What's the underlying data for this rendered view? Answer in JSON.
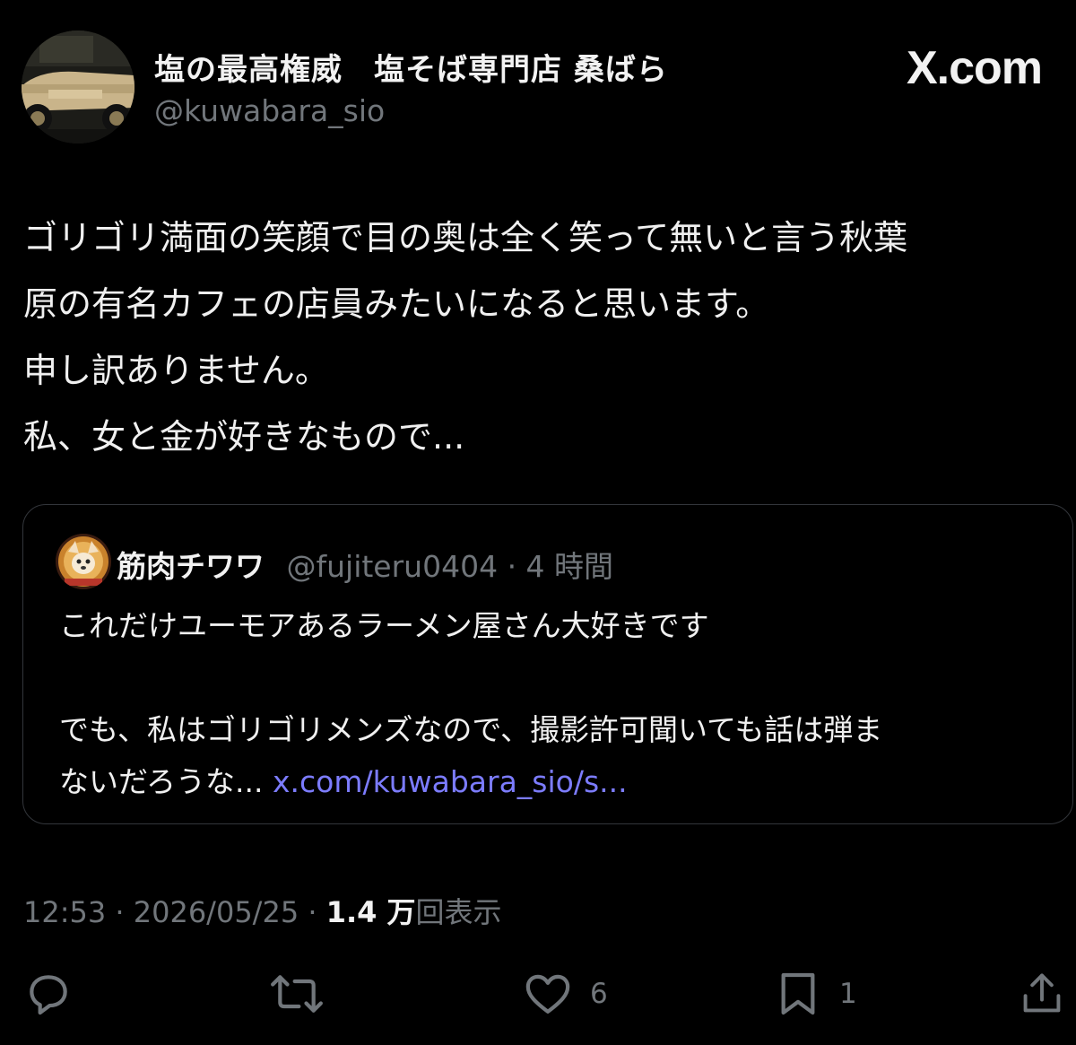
{
  "header": {
    "display_name": "塩の最高権威　塩そば専門店 桑ばら",
    "handle": "@kuwabara_sio",
    "brand": "X.com"
  },
  "post": {
    "lines": [
      "ゴリゴリ満面の笑顔で目の奥は全く笑って無いと言う秋葉",
      "原の有名カフェの店員みたいになると思います。",
      "申し訳ありません。",
      "私、女と金が好きなもので..."
    ]
  },
  "quote": {
    "name": "筋肉チワワ",
    "handle": "@fujiteru0404",
    "time": "· 4 時間",
    "line1": "これだけユーモアあるラーメン屋さん大好きです",
    "line2": "でも、私はゴリゴリメンズなので、撮影許可聞いても話は弾ま",
    "line3": "ないだろうな...",
    "link": "x.com/kuwabara_sio/s..."
  },
  "meta": {
    "time": "12:53",
    "date": "2026/05/25",
    "views_count": "1.4 万",
    "views_label": "回表示",
    "sep": " · "
  },
  "actions": {
    "reply_count": "",
    "repost_count": "",
    "like_count": "6",
    "bookmark_count": "1"
  },
  "icons": {
    "avatar": "vintage-car-avatar",
    "quote_avatar": "chihuahua-avatar",
    "reply": "reply-icon",
    "repost": "repost-icon",
    "like": "heart-icon",
    "bookmark": "bookmark-icon",
    "share": "share-icon"
  },
  "colors": {
    "background": "#000000",
    "text": "#e7e9ea",
    "muted": "#71767b",
    "link": "#7c7cff",
    "border": "#33363b"
  }
}
